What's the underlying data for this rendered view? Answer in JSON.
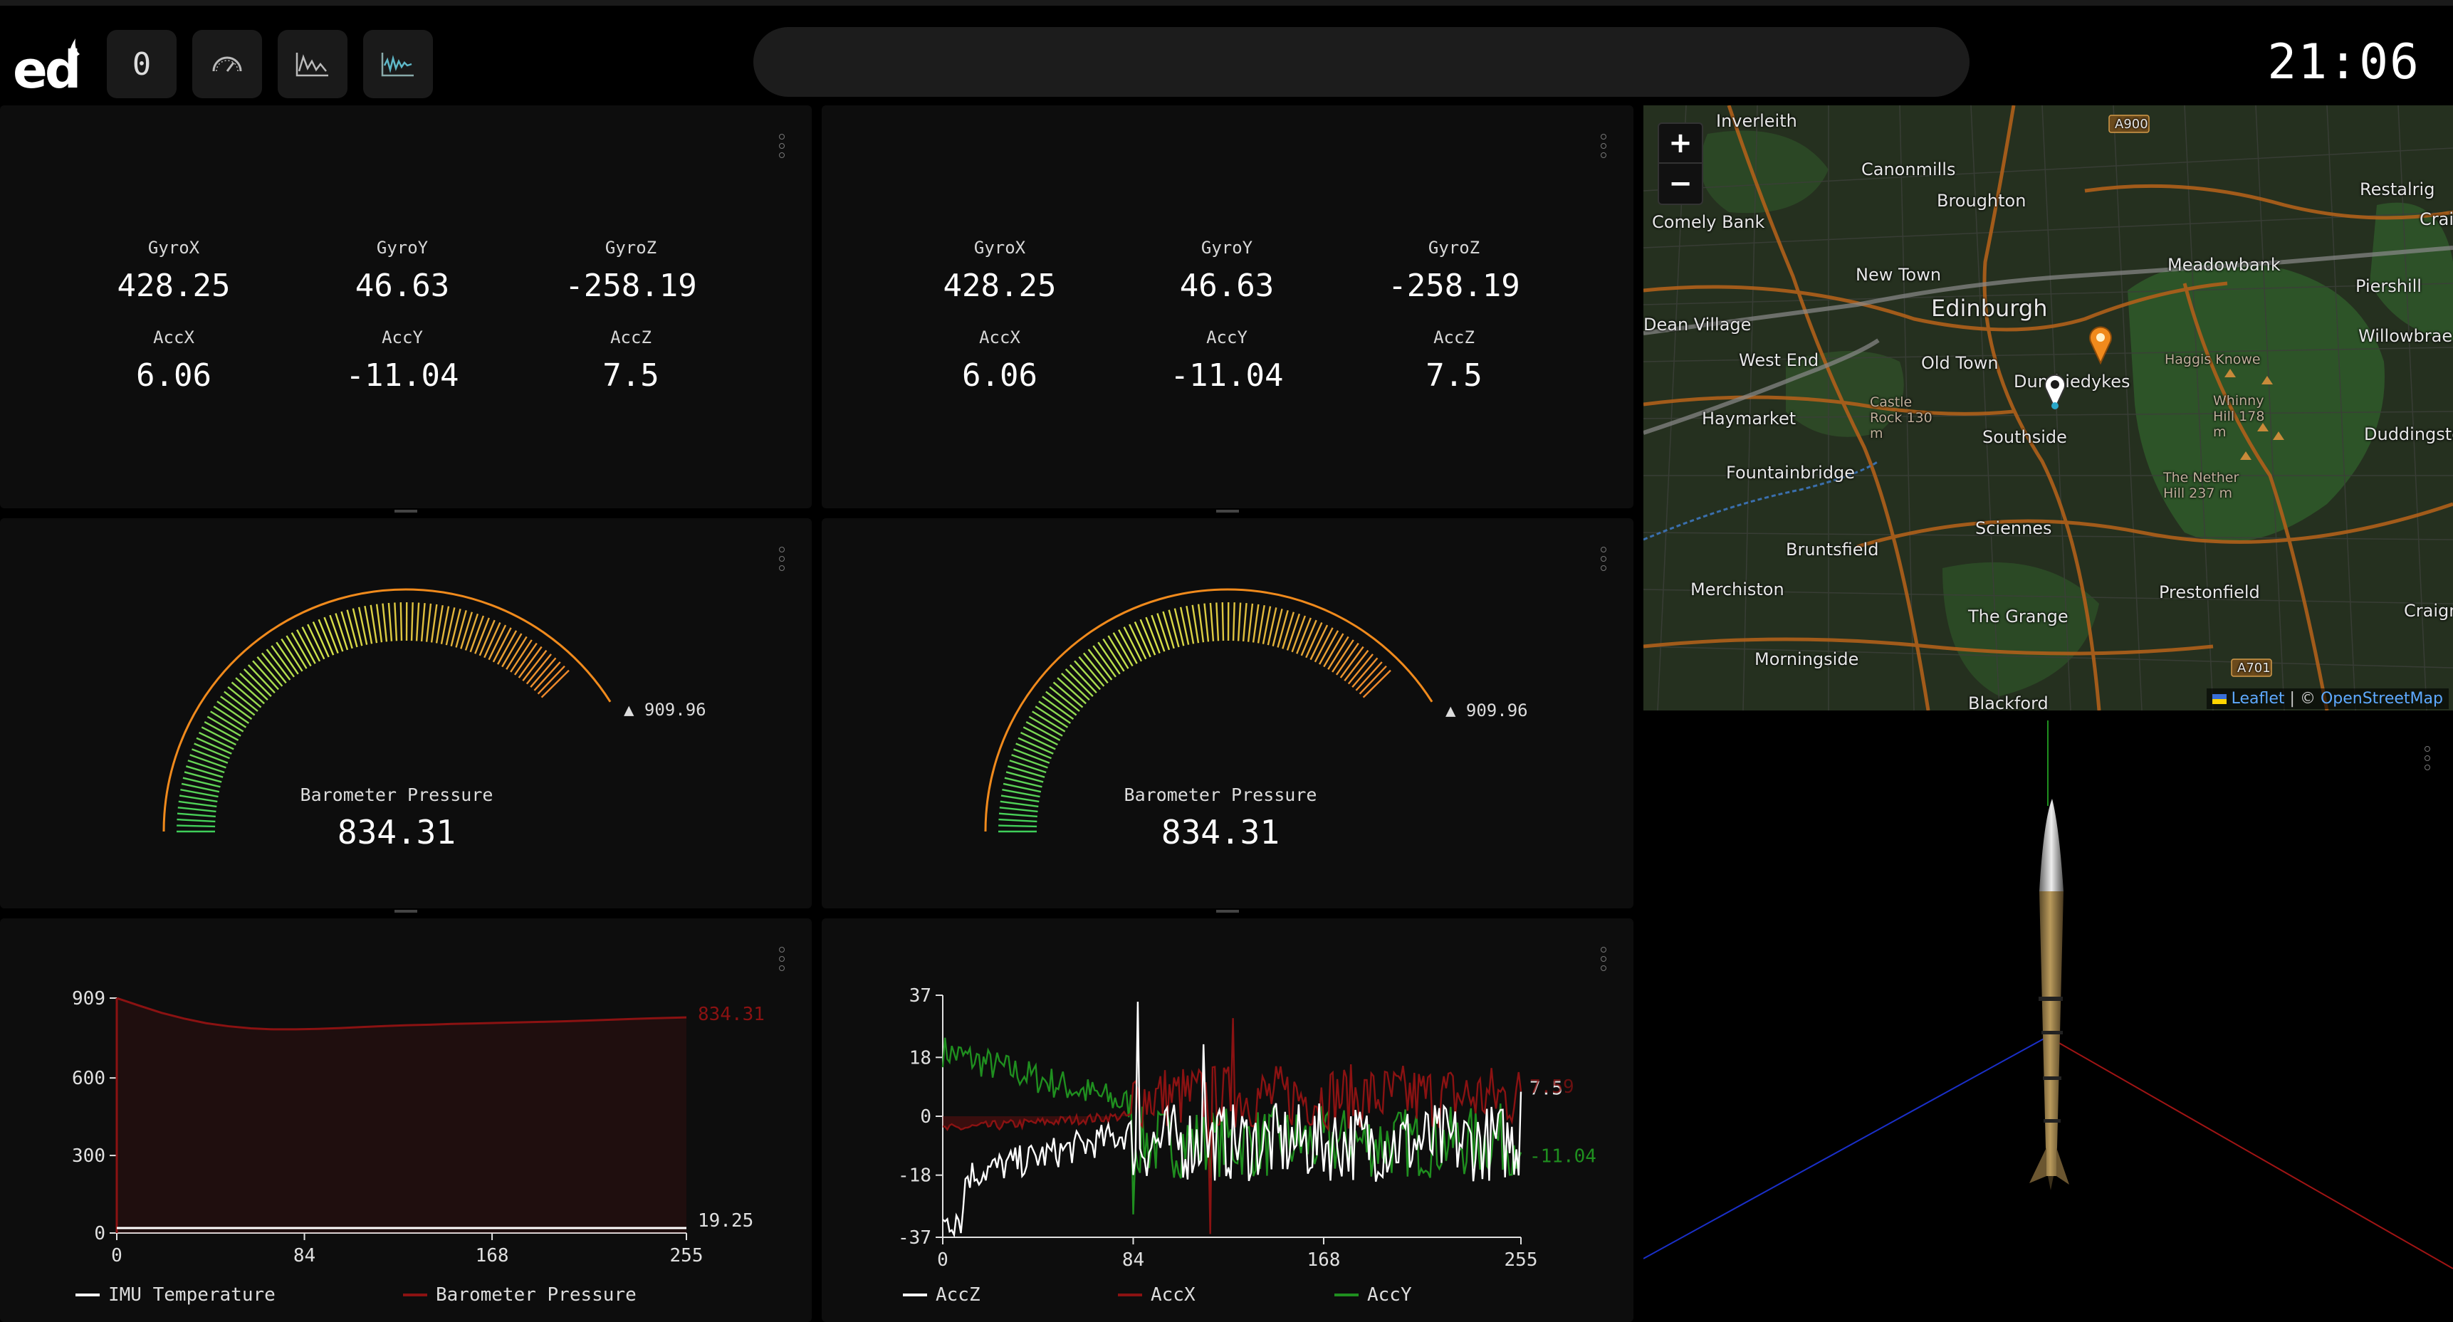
{
  "app": {
    "logo_text": "ed",
    "counter": "0",
    "clock": "21:06",
    "toolbar_icons": [
      "gauge-icon",
      "line-chart-icon",
      "waveform-icon"
    ]
  },
  "readouts": [
    {
      "items": [
        {
          "label": "GyroX",
          "value": "428.25"
        },
        {
          "label": "GyroY",
          "value": "46.63"
        },
        {
          "label": "GyroZ",
          "value": "-258.19"
        },
        {
          "label": "AccX",
          "value": "6.06"
        },
        {
          "label": "AccY",
          "value": "-11.04"
        },
        {
          "label": "AccZ",
          "value": "7.5"
        }
      ]
    },
    {
      "items": [
        {
          "label": "GyroX",
          "value": "428.25"
        },
        {
          "label": "GyroY",
          "value": "46.63"
        },
        {
          "label": "GyroZ",
          "value": "-258.19"
        },
        {
          "label": "AccX",
          "value": "6.06"
        },
        {
          "label": "AccY",
          "value": "-11.04"
        },
        {
          "label": "AccZ",
          "value": "7.5"
        }
      ]
    }
  ],
  "gauges": [
    {
      "title": "Barometer Pressure",
      "value": "834.31",
      "max_label": "909.96",
      "level": 834.31,
      "max": 909.96
    },
    {
      "title": "Barometer Pressure",
      "value": "834.31",
      "max_label": "909.96",
      "level": 834.31,
      "max": 909.96
    }
  ],
  "map": {
    "labels": [
      "Inverleith",
      "Canonmills",
      "Broughton",
      "Comely Bank",
      "Restalrig",
      "Craigen",
      "New Town",
      "Meadowbank",
      "Piershill",
      "Edinburgh",
      "Dean Village",
      "Willowbrae",
      "West End",
      "Old Town",
      "Dumbiedykes",
      "Haggis Knowe",
      "Castle Rock 130 m",
      "Whinny Hill 178 m",
      "Haymarket",
      "Southside",
      "Duddingsto",
      "Fountainbridge",
      "The Nether Hill 237 m",
      "Sciennes",
      "Bruntsfield",
      "Merchiston",
      "Prestonfield",
      "Craigmillar",
      "The Grange",
      "Morningside",
      "Blackford",
      "A900",
      "A701"
    ],
    "zoom_in": "+",
    "zoom_out": "−",
    "attribution_leaflet": "Leaflet",
    "attribution_sep": "| ©",
    "attribution_osm": "OpenStreetMap"
  },
  "colors": {
    "pressure": "#8b1212",
    "temperature": "#ffffff",
    "accx": "#8b1212",
    "accy": "#1f8f1f",
    "accz": "#ffffff",
    "gauge_arc": "#f08a1c",
    "gauge_low": "#3fcf5a",
    "gauge_mid": "#d6e24a",
    "gauge_high": "#f08a2c"
  },
  "chart_data": [
    {
      "type": "line",
      "x_ticks": [
        "0",
        "84",
        "168",
        "255"
      ],
      "y_ticks": [
        "0",
        "300",
        "600",
        "909"
      ],
      "xlim": [
        0,
        255
      ],
      "ylim": [
        0,
        909
      ],
      "series": [
        {
          "name": "IMU Temperature",
          "end_label": "19.25",
          "x": [
            0,
            255
          ],
          "values": [
            19.25,
            19.25
          ]
        },
        {
          "name": "Barometer Pressure",
          "end_label": "834.31",
          "x": [
            0,
            10,
            20,
            30,
            40,
            50,
            60,
            70,
            80,
            90,
            100,
            110,
            120,
            130,
            140,
            150,
            160,
            170,
            180,
            190,
            200,
            210,
            220,
            230,
            240,
            255
          ],
          "values": [
            909,
            880,
            852,
            830,
            812,
            800,
            792,
            788,
            788,
            790,
            793,
            797,
            801,
            804,
            806,
            809,
            811,
            813,
            815,
            817,
            819,
            822,
            825,
            828,
            831,
            834.31
          ]
        }
      ]
    },
    {
      "type": "line",
      "x_ticks": [
        "0",
        "84",
        "168",
        "255"
      ],
      "y_ticks": [
        "-37",
        "-18",
        "0",
        "18",
        "37"
      ],
      "xlim": [
        0,
        255
      ],
      "ylim": [
        -37,
        37
      ],
      "series": [
        {
          "name": "AccZ",
          "end_label": "7.5"
        },
        {
          "name": "AccX",
          "end_label": "7.59"
        },
        {
          "name": "AccY",
          "end_label": "-11.04"
        }
      ]
    }
  ]
}
